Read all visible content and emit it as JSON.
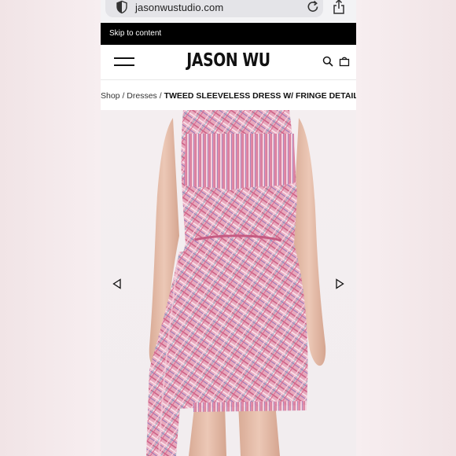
{
  "browser": {
    "url": "jasonwustudio.com"
  },
  "skip": {
    "label": "Skip to content"
  },
  "header": {
    "logo": "JASON WU"
  },
  "breadcrumb": {
    "shop": "Shop",
    "sep1": " / ",
    "dresses": "Dresses",
    "sep2": " / ",
    "current": "TWEED SLEEVELESS DRESS W/ FRINGE DETAIL"
  },
  "colors": {
    "tweed_pink": "#d98aa6",
    "tweed_light": "#f1c9d6",
    "skin": "#e8c2ae",
    "black_bar": "#000000"
  }
}
